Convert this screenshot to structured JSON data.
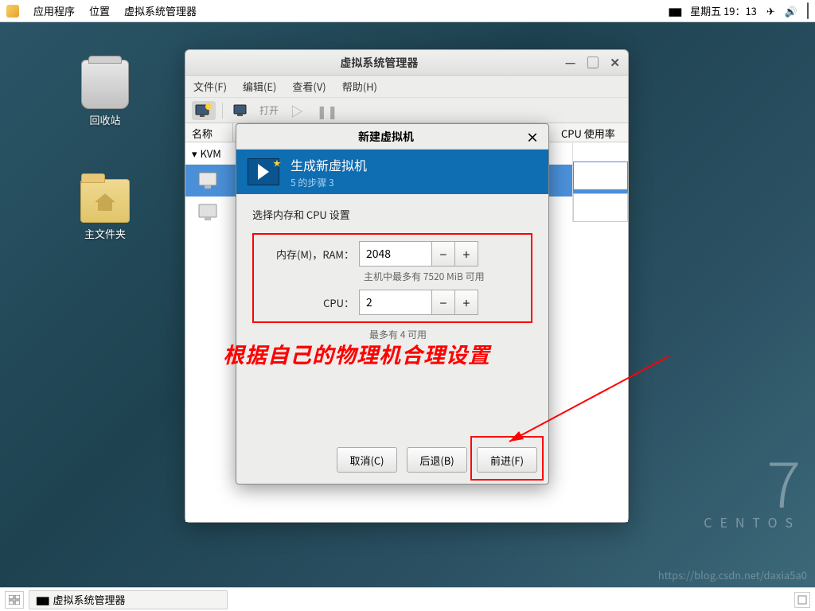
{
  "panel": {
    "applications": "应用程序",
    "places": "位置",
    "app_name": "虚拟系统管理器",
    "clock": "星期五 19：13"
  },
  "desktop": {
    "trash": "回收站",
    "home": "主文件夹"
  },
  "main_window": {
    "title": "虚拟系统管理器",
    "menu": {
      "file": "文件(F)",
      "edit": "编辑(E)",
      "view": "查看(V)",
      "help": "帮助(H)"
    },
    "toolbar_open": "打开",
    "columns": {
      "name": "名称",
      "cpu": "CPU 使用率"
    },
    "kvm": "KVM"
  },
  "dialog": {
    "title": "新建虚拟机",
    "header_title": "生成新虚拟机",
    "header_step": "5 的步骤 3",
    "section": "选择内存和 CPU 设置",
    "mem_label": "内存(M)，RAM：",
    "mem_value": "2048",
    "mem_hint": "主机中最多有 7520 MiB 可用",
    "cpu_label": "CPU：",
    "cpu_value": "2",
    "cpu_hint": "最多有 4 可用",
    "btn_cancel": "取消(C)",
    "btn_back": "后退(B)",
    "btn_forward": "前进(F)"
  },
  "annotation": "根据自己的物理机合理设置",
  "centos": {
    "num": "7",
    "name": "CENTOS"
  },
  "watermark": "https://blog.csdn.net/daxia5a0",
  "taskbar": {
    "app": "虚拟系统管理器"
  }
}
